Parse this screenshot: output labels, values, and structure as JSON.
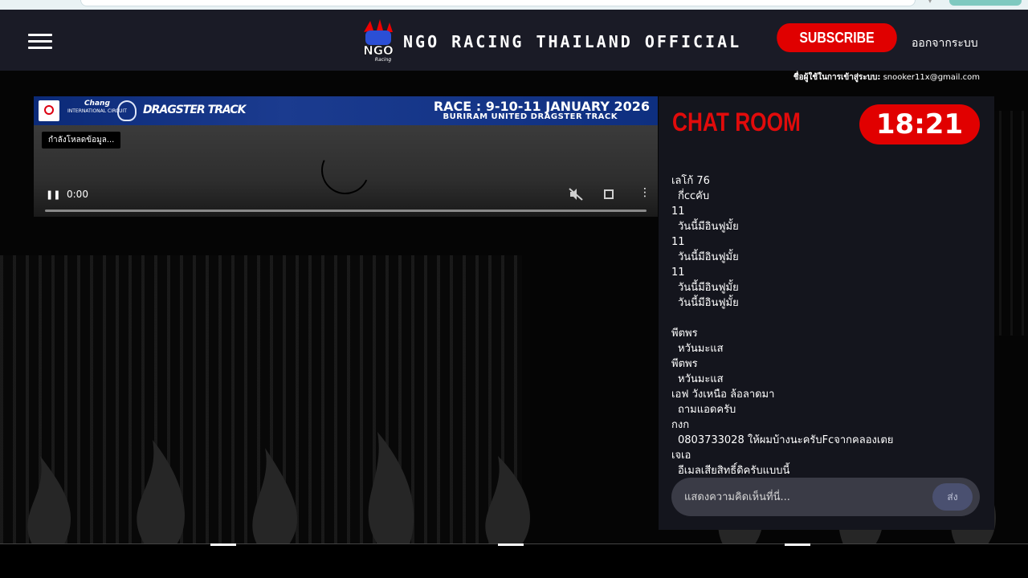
{
  "header": {
    "brand": "NGO RACING THAILAND OFFICIAL",
    "subscribe_label": "SUBSCRIBE",
    "logout_label": "ออกจากระบบ",
    "user_label_prefix": "ชื่อผู้ใช้ในการเข้าสู่ระบบ:",
    "user_email": "snooker11x@gmail.com"
  },
  "video": {
    "banner": {
      "chang_title": "Chang",
      "chang_sub": "INTERNATIONAL CIRCUIT",
      "dragster": "DRAGSTER TRACK",
      "race_title": "RACE : 9-10-11 JANUARY 2026",
      "race_subtitle": "BURIRAM UNITED DRAGSTER TRACK"
    },
    "loading_label": "กำลังโหลดข้อมูล...",
    "current_time": "0:00",
    "icons": [
      "pause-icon",
      "mute-icon",
      "fullscreen-icon",
      "more-vert-icon"
    ]
  },
  "chat": {
    "title": "CHAT ROOM",
    "clock": "18:21",
    "messages": [
      {
        "name": "เลโก้ 76",
        "text": "กี่ccคับ"
      },
      {
        "name": "11",
        "text": "วันนี้มีอินฟูมั้ย"
      },
      {
        "name": "11",
        "text": "วันนี้มีอินฟูมั้ย"
      },
      {
        "name": "11",
        "text": "วันนี้มีอินฟูมั้ย"
      },
      {
        "name": "",
        "text": "วันนี้มีอินฟูมั้ย"
      },
      {
        "name": "พีตพร",
        "text": "หวันมะแส"
      },
      {
        "name": "พีตพร",
        "text": "หวันมะแส"
      },
      {
        "name": "เอฟ วังเหนือ ล้อลาดมา",
        "text": "ถามแอดครับ"
      },
      {
        "name": "กงก",
        "text": "0803733028 ให้ผมบ้างนะครับFcจากคลองเตย"
      },
      {
        "name": "เจเอ",
        "text": "อีเมลเสียสิทธิ์ดิครับแบบนี้"
      }
    ],
    "input_placeholder": "แสดงความคิดเห็นที่นี่...",
    "send_label": "ส่ง"
  }
}
